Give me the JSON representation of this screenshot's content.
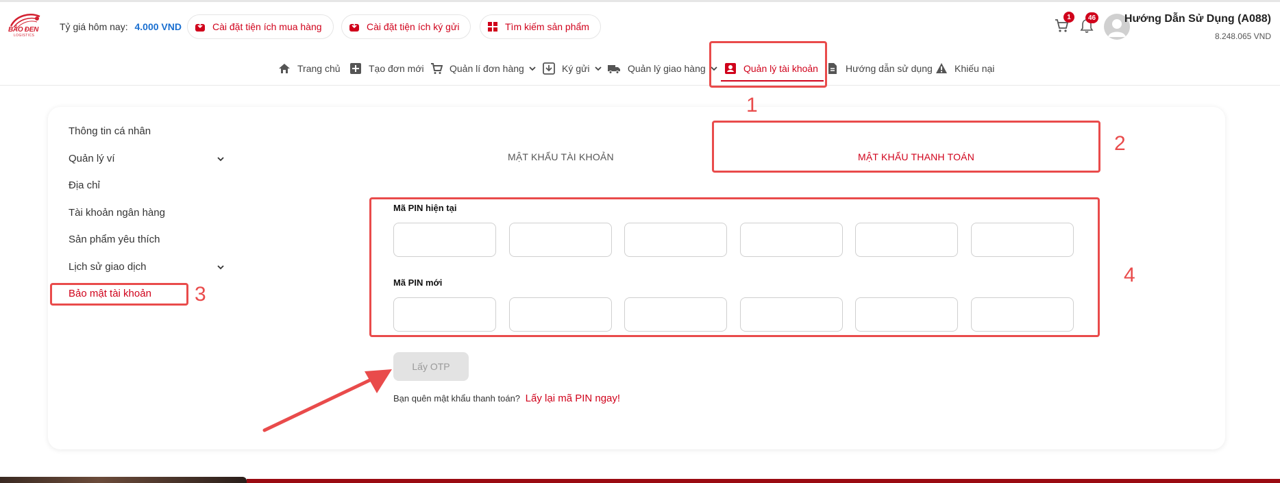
{
  "brand": {
    "name": "BẢO ĐEN",
    "sub": "LOGISTICS",
    "color": "#d32030"
  },
  "header": {
    "rate_label": "Tỷ giá hôm nay:",
    "rate_value": "4.000 VND",
    "pills": [
      {
        "label": "Cài đặt tiện ích mua hàng",
        "icon": "download-box-icon"
      },
      {
        "label": "Cài đặt tiện ích ký gửi",
        "icon": "download-box-icon"
      },
      {
        "label": "Tìm kiếm sản phẩm",
        "icon": "grid-search-icon"
      }
    ],
    "cart_count": "1",
    "notification_count": "46",
    "user_name": "Hướng Dẫn Sử Dụng (A088)",
    "user_balance": "8.248.065 VND"
  },
  "nav": {
    "items": [
      {
        "label": "Trang chủ",
        "icon": "home-icon"
      },
      {
        "label": "Tạo đơn mới",
        "icon": "plus-square-icon"
      },
      {
        "label": "Quản lí đơn hàng",
        "icon": "cart-icon",
        "has_dropdown": true
      },
      {
        "label": "Ký gửi",
        "icon": "box-icon",
        "has_dropdown": true
      },
      {
        "label": "Quản lý giao hàng",
        "icon": "truck-icon",
        "has_dropdown": true
      },
      {
        "label": "Quản lý tài khoản",
        "icon": "account-icon",
        "active": true
      },
      {
        "label": "Hướng dẫn sử dụng",
        "icon": "document-icon"
      },
      {
        "label": "Khiếu nại",
        "icon": "warning-icon"
      }
    ]
  },
  "sidebar": {
    "items": [
      {
        "label": "Thông tin cá nhân"
      },
      {
        "label": "Quản lý ví",
        "has_dropdown": true
      },
      {
        "label": "Địa chỉ"
      },
      {
        "label": "Tài khoản ngân hàng"
      },
      {
        "label": "Sản phẩm yêu thích"
      },
      {
        "label": "Lịch sử giao dịch",
        "has_dropdown": true
      },
      {
        "label": "Bảo mật tài khoản",
        "active": true
      }
    ]
  },
  "tabs": [
    {
      "label": "MẬT KHẨU TÀI KHOẢN"
    },
    {
      "label": "MẬT KHẨU THANH TOÁN",
      "active": true
    }
  ],
  "form": {
    "current_pin_label": "Mã PIN hiện tại",
    "new_pin_label": "Mã PIN mới",
    "current_pin": [
      "",
      "",
      "",
      "",
      "",
      ""
    ],
    "new_pin": [
      "",
      "",
      "",
      "",
      "",
      ""
    ],
    "otp_button": "Lấy OTP",
    "forgot_text": "Bạn quên mật khẩu thanh toán?",
    "forgot_link": "Lấy lại mã PIN ngay!"
  },
  "annotations": [
    "1",
    "2",
    "3",
    "4"
  ],
  "colors": {
    "accent": "#d0021b",
    "annotation": "#e94b4b",
    "link": "#1a6fd0"
  }
}
